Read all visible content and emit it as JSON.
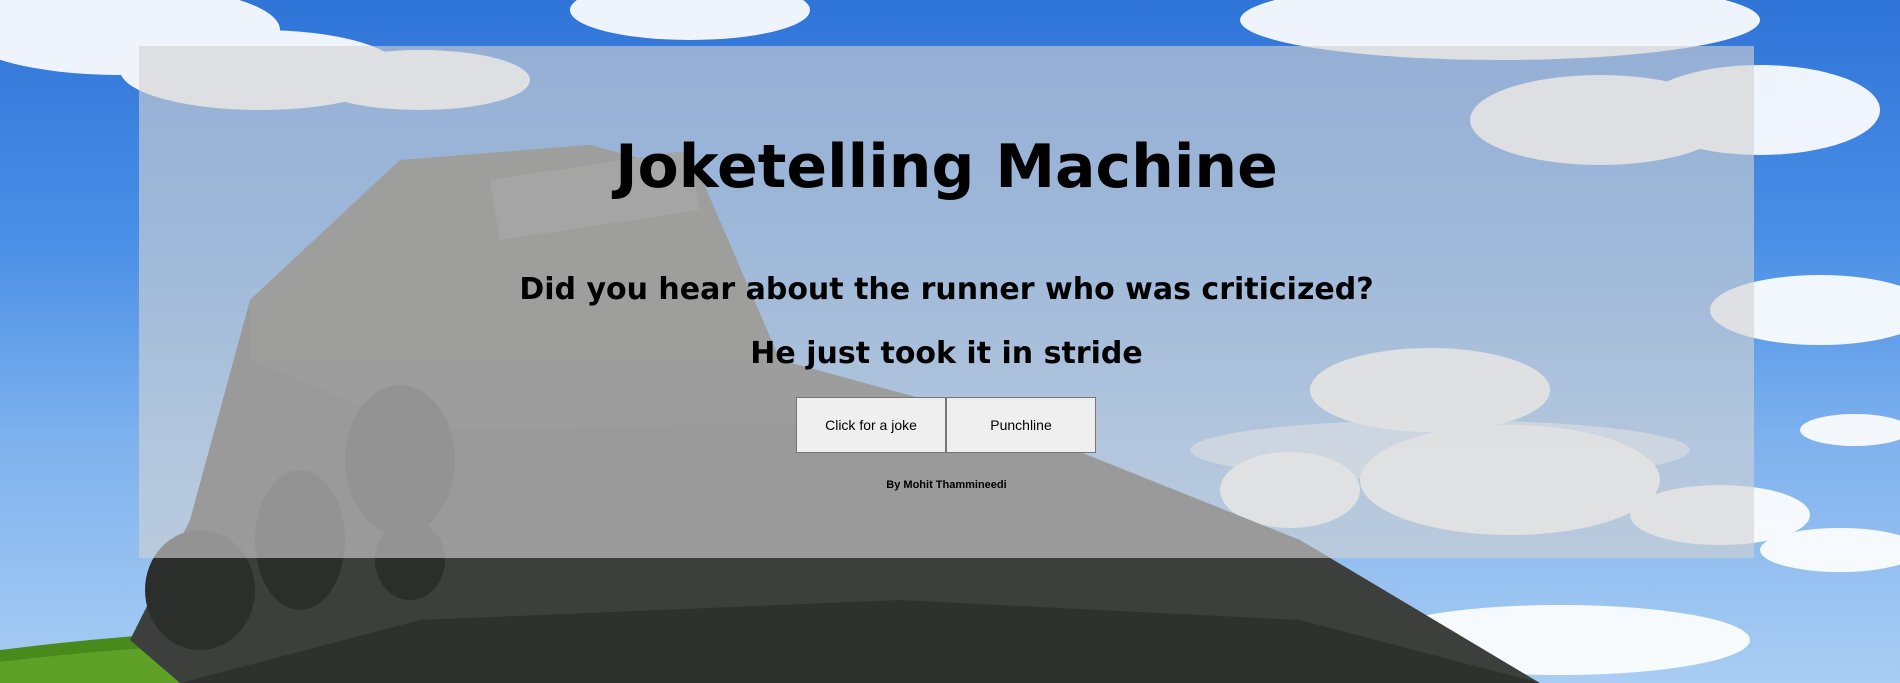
{
  "page": {
    "title": "Joketelling Machine",
    "setup": "Did you hear about the runner who was criticized?",
    "punchline": "He just took it in stride",
    "buttons": {
      "joke_label": "Click for a joke",
      "punchline_label": "Punchline"
    },
    "byline": "By Mohit Thammineedi"
  },
  "colors": {
    "sky": "#3f85e0",
    "grass": "#4a8a1c",
    "panel": "rgba(210,210,210,0.62)",
    "button_bg": "#efefef",
    "button_border": "#767676",
    "text": "#000000"
  }
}
